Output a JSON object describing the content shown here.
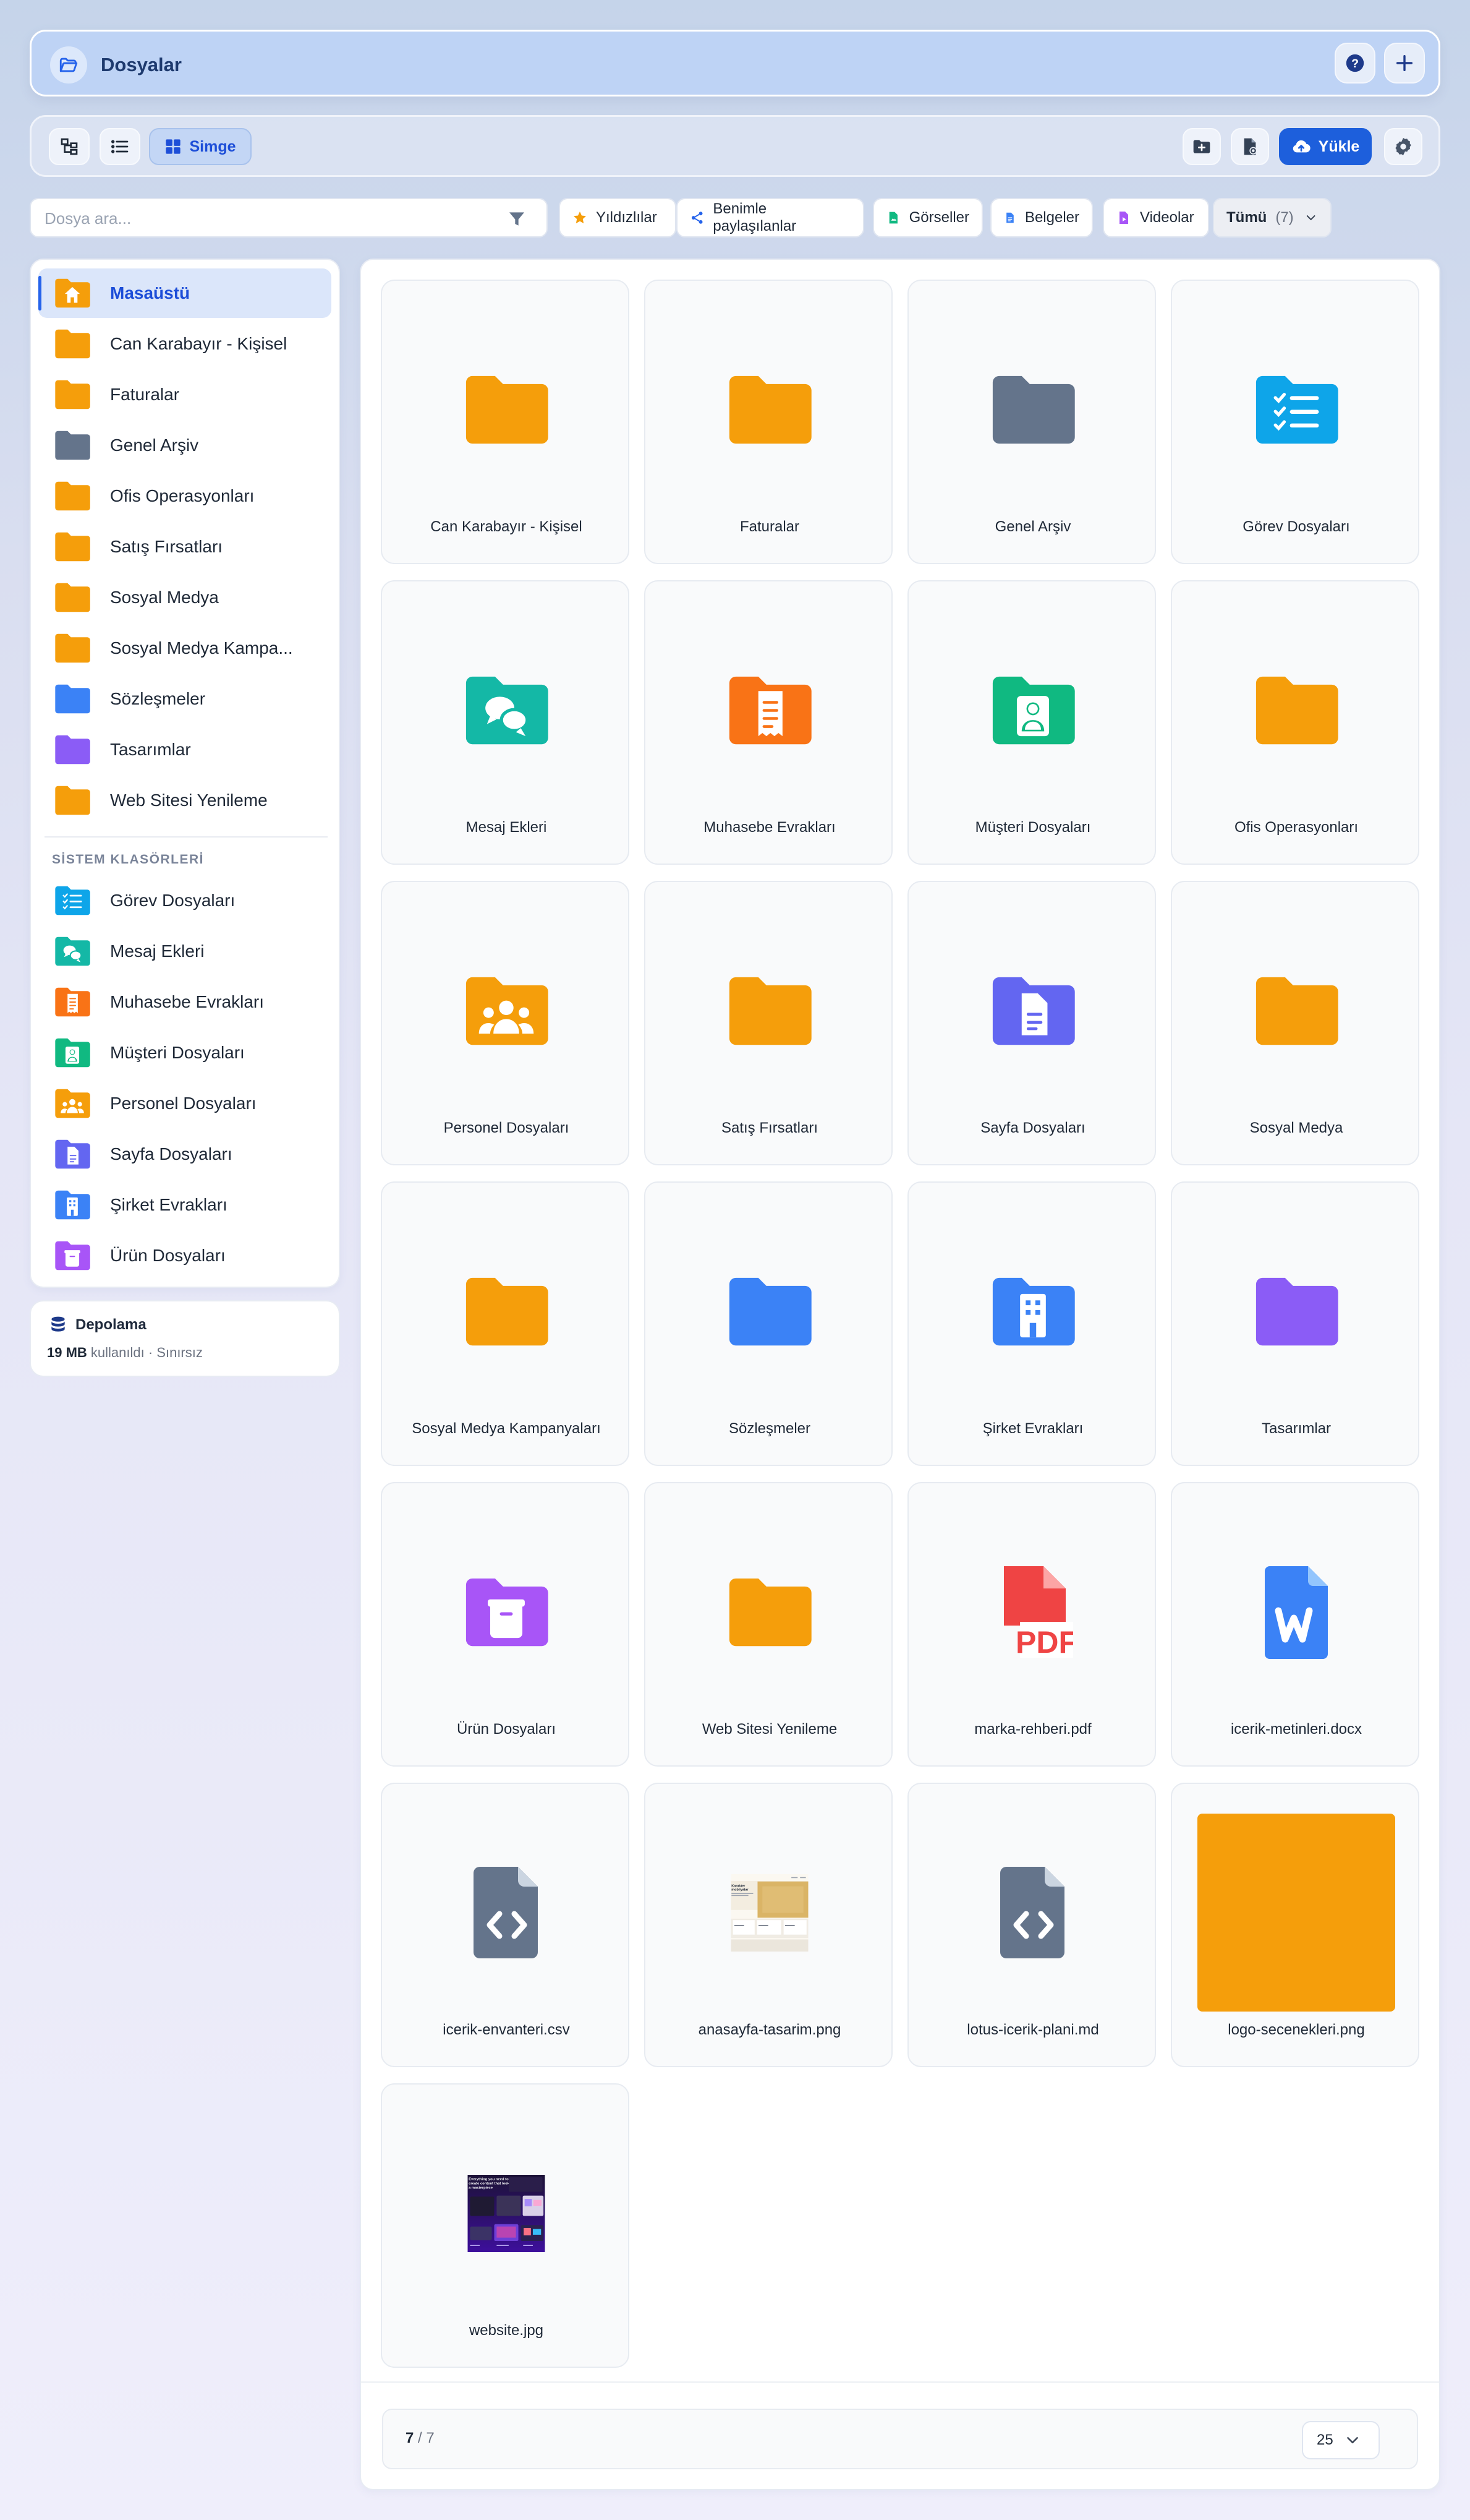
{
  "header": {
    "title": "Dosyalar"
  },
  "toolbar": {
    "view_icon_label": "Simge",
    "upload_label": "Yükle"
  },
  "search": {
    "placeholder": "Dosya ara..."
  },
  "filters": [
    {
      "label": "Yıldızlılar",
      "icon": "star-icon",
      "color": "#f59e0b"
    },
    {
      "label": "Benimle paylaşılanlar",
      "icon": "share-icon",
      "color": "#2563eb"
    },
    {
      "label": "Görseller",
      "icon": "image-file-icon",
      "color": "#10b981"
    },
    {
      "label": "Belgeler",
      "icon": "document-file-icon",
      "color": "#3b82f6"
    },
    {
      "label": "Videolar",
      "icon": "video-file-icon",
      "color": "#a855f7"
    }
  ],
  "type_select": {
    "value": "Tümü",
    "count": "(7)"
  },
  "sidebar": {
    "folders": [
      {
        "label": "Masaüstü",
        "icon": "home-folder-icon",
        "color": "#f59e0b",
        "active": true
      },
      {
        "label": "Can Karabayır - Kişisel",
        "icon": "folder-icon",
        "color": "#f59e0b"
      },
      {
        "label": "Faturalar",
        "icon": "folder-icon",
        "color": "#f59e0b"
      },
      {
        "label": "Genel Arşiv",
        "icon": "folder-icon",
        "color": "#64748b"
      },
      {
        "label": "Ofis Operasyonları",
        "icon": "folder-icon",
        "color": "#f59e0b"
      },
      {
        "label": "Satış Fırsatları",
        "icon": "folder-icon",
        "color": "#f59e0b"
      },
      {
        "label": "Sosyal Medya",
        "icon": "folder-icon",
        "color": "#f59e0b"
      },
      {
        "label": "Sosyal Medya Kampa...",
        "icon": "folder-icon",
        "color": "#f59e0b"
      },
      {
        "label": "Sözleşmeler",
        "icon": "folder-icon",
        "color": "#3b82f6"
      },
      {
        "label": "Tasarımlar",
        "icon": "folder-icon",
        "color": "#8b5cf6"
      },
      {
        "label": "Web Sitesi Yenileme",
        "icon": "folder-icon",
        "color": "#f59e0b"
      }
    ],
    "section_title": "SİSTEM KLASÖRLERİ",
    "system": [
      {
        "label": "Görev Dosyaları",
        "icon": "task-folder-icon",
        "color": "#0ea5e9"
      },
      {
        "label": "Mesaj Ekleri",
        "icon": "chat-folder-icon",
        "color": "#14b8a6"
      },
      {
        "label": "Muhasebe Evrakları",
        "icon": "receipt-folder-icon",
        "color": "#f97316"
      },
      {
        "label": "Müşteri Dosyaları",
        "icon": "customer-folder-icon",
        "color": "#10b981"
      },
      {
        "label": "Personel Dosyaları",
        "icon": "people-folder-icon",
        "color": "#f59e0b"
      },
      {
        "label": "Sayfa Dosyaları",
        "icon": "page-folder-icon",
        "color": "#6366f1"
      },
      {
        "label": "Şirket Evrakları",
        "icon": "building-folder-icon",
        "color": "#3b82f6"
      },
      {
        "label": "Ürün Dosyaları",
        "icon": "product-folder-icon",
        "color": "#a855f7"
      }
    ]
  },
  "storage": {
    "title": "Depolama",
    "used": "19 MB",
    "detail": "kullanıldı · Sınırsız"
  },
  "grid": [
    {
      "name": "Can Karabayır - Kişisel",
      "kind": "folder",
      "color": "#f59e0b",
      "icon": "folder-icon"
    },
    {
      "name": "Faturalar",
      "kind": "folder",
      "color": "#f59e0b",
      "icon": "folder-icon"
    },
    {
      "name": "Genel Arşiv",
      "kind": "folder",
      "color": "#64748b",
      "icon": "folder-icon"
    },
    {
      "name": "Görev Dosyaları",
      "kind": "folder",
      "color": "#0ea5e9",
      "icon": "task-folder-icon",
      "glyph": "task"
    },
    {
      "name": "Mesaj Ekleri",
      "kind": "folder",
      "color": "#14b8a6",
      "icon": "chat-folder-icon",
      "glyph": "chat"
    },
    {
      "name": "Muhasebe Evrakları",
      "kind": "folder",
      "color": "#f97316",
      "icon": "receipt-folder-icon",
      "glyph": "receipt"
    },
    {
      "name": "Müşteri Dosyaları",
      "kind": "folder",
      "color": "#10b981",
      "icon": "customer-folder-icon",
      "glyph": "person"
    },
    {
      "name": "Ofis Operasyonları",
      "kind": "folder",
      "color": "#f59e0b",
      "icon": "folder-icon"
    },
    {
      "name": "Personel Dosyaları",
      "kind": "folder",
      "color": "#f59e0b",
      "icon": "people-folder-icon",
      "glyph": "people"
    },
    {
      "name": "Satış Fırsatları",
      "kind": "folder",
      "color": "#f59e0b",
      "icon": "folder-icon"
    },
    {
      "name": "Sayfa Dosyaları",
      "kind": "folder",
      "color": "#6366f1",
      "icon": "page-folder-icon",
      "glyph": "page"
    },
    {
      "name": "Sosyal Medya",
      "kind": "folder",
      "color": "#f59e0b",
      "icon": "folder-icon"
    },
    {
      "name": "Sosyal Medya Kampanyaları",
      "kind": "folder",
      "color": "#f59e0b",
      "icon": "folder-icon"
    },
    {
      "name": "Sözleşmeler",
      "kind": "folder",
      "color": "#3b82f6",
      "icon": "folder-icon"
    },
    {
      "name": "Şirket Evrakları",
      "kind": "folder",
      "color": "#3b82f6",
      "icon": "building-folder-icon",
      "glyph": "building"
    },
    {
      "name": "Tasarımlar",
      "kind": "folder",
      "color": "#8b5cf6",
      "icon": "folder-icon"
    },
    {
      "name": "Ürün Dosyaları",
      "kind": "folder",
      "color": "#a855f7",
      "icon": "product-folder-icon",
      "glyph": "box"
    },
    {
      "name": "Web Sitesi Yenileme",
      "kind": "folder",
      "color": "#f59e0b",
      "icon": "folder-icon"
    },
    {
      "name": "marka-rehberi.pdf",
      "kind": "pdf",
      "color": "#ef4444",
      "icon": "pdf-file-icon"
    },
    {
      "name": "icerik-metinleri.docx",
      "kind": "docx",
      "color": "#3b82f6",
      "icon": "word-file-icon"
    },
    {
      "name": "icerik-envanteri.csv",
      "kind": "code",
      "color": "#64748b",
      "icon": "code-file-icon"
    },
    {
      "name": "anasayfa-tasarim.png",
      "kind": "image-light",
      "icon": "image-preview"
    },
    {
      "name": "lotus-icerik-plani.md",
      "kind": "code",
      "color": "#64748b",
      "icon": "code-file-icon"
    },
    {
      "name": "logo-secenekleri.png",
      "kind": "image-solid",
      "color": "#f59e0b",
      "icon": "image-preview"
    },
    {
      "name": "website.jpg",
      "kind": "image-dark",
      "icon": "image-preview"
    }
  ],
  "pagination": {
    "current": "7",
    "separator": "/",
    "total": "7",
    "per_page": "25"
  }
}
